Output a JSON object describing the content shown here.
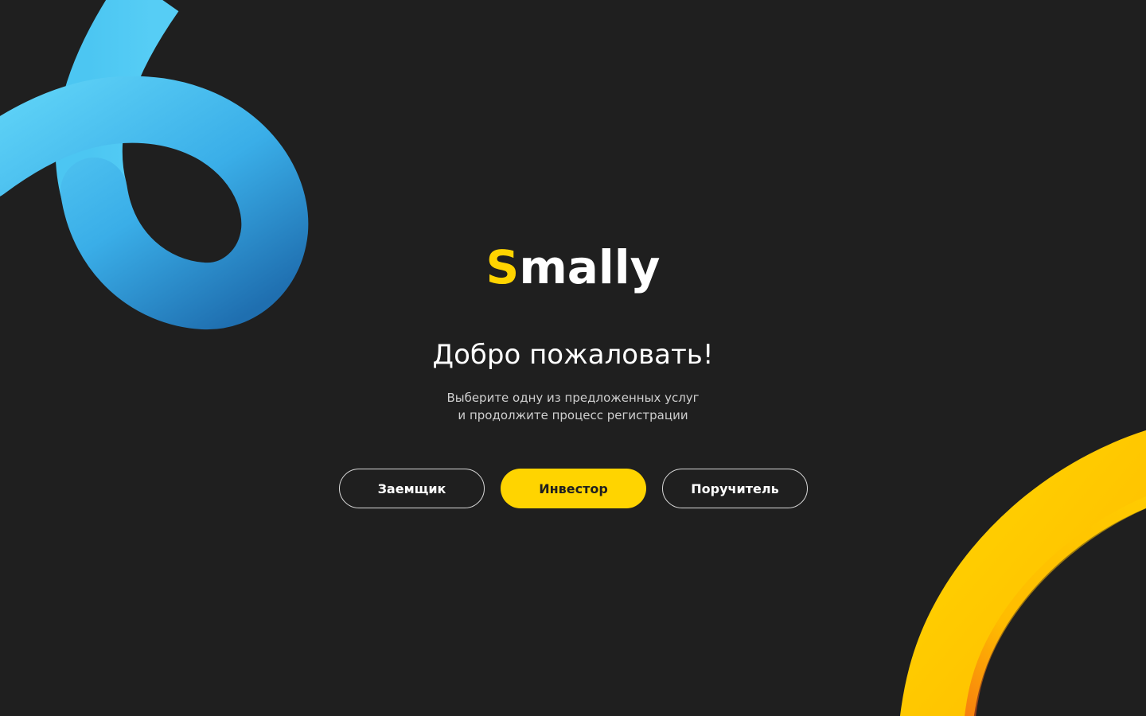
{
  "brand": {
    "logo_first_letter": "S",
    "logo_rest": "mally",
    "logo_alt": "Smally",
    "accent_color": "#ffd400",
    "background_color": "#1f1f1f",
    "secondary_color": "#4ec8f4"
  },
  "welcome": {
    "title": "Добро пожаловать!",
    "subtitle_line1": "Выберите одну из предложенных услуг",
    "subtitle_line2": "и продолжите процесс регистрации"
  },
  "roles": {
    "borrower_label": "Заемщик",
    "investor_label": "Инвестор",
    "guarantor_label": "Поручитель",
    "selected": "Инвестор"
  },
  "decor": {
    "top_left": "blue-loop-ribbon",
    "bottom_right": "yellow-orange-arc-ribbon"
  }
}
